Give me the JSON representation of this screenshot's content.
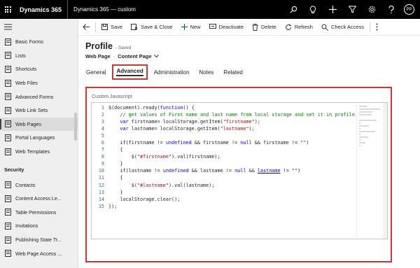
{
  "topbar": {
    "app_title": "Dynamics 365",
    "env_title": "Dynamics 365 — custom",
    "avatar_initials": "PP",
    "icons": [
      "search-icon",
      "lightbulb-icon",
      "plus-icon",
      "filter-icon",
      "gear-icon",
      "help-icon"
    ]
  },
  "sidebar": {
    "items_top": [
      {
        "label": "Basic Forms",
        "icon": "form-icon"
      },
      {
        "label": "Lists",
        "icon": "list-icon"
      },
      {
        "label": "Shortcuts",
        "icon": "shortcut-icon"
      },
      {
        "label": "Web Files",
        "icon": "file-icon"
      },
      {
        "label": "Advanced Forms",
        "icon": "form-icon"
      },
      {
        "label": "Web Link Sets",
        "icon": "link-icon"
      },
      {
        "label": "Web Pages",
        "icon": "page-icon",
        "active": true
      },
      {
        "label": "Portal Languages",
        "icon": "globe-icon"
      },
      {
        "label": "Web Templates",
        "icon": "template-icon"
      }
    ],
    "section": "Security",
    "items_security": [
      {
        "label": "Contacts",
        "icon": "person-icon"
      },
      {
        "label": "Content Access Le...",
        "icon": "document-icon"
      },
      {
        "label": "Table Permissions",
        "icon": "document-icon"
      },
      {
        "label": "Invitations",
        "icon": "mail-icon"
      },
      {
        "label": "Publishing State Tr...",
        "icon": "flow-icon"
      },
      {
        "label": "Web Page Access ...",
        "icon": "document-icon"
      }
    ]
  },
  "commands": {
    "save": "Save",
    "save_close": "Save & Close",
    "new": "New",
    "deactivate": "Deactivate",
    "delete": "Delete",
    "refresh": "Refresh",
    "check_access": "Check Access"
  },
  "record": {
    "title": "Profile",
    "status": "- Saved",
    "entity": "Web Page",
    "form": "Content Page"
  },
  "tabs": [
    "General",
    "Advanced",
    "Administration",
    "Notes",
    "Related"
  ],
  "active_tab": "Advanced",
  "panel": {
    "label": "Custom Javascript",
    "lines": [
      "$(document).ready(function() {",
      "    // get values of First name and last name from local storage and set it in profile",
      "    var firstname= localStorage.getItem(\"firstname\");",
      "    var lastname= localStorage.getItem(\"lastname\");",
      "",
      "    if(firstname != undefined && firstname != null && firstname != \"\")",
      "    {",
      "        $(\"#firstname\").val(firstname);",
      "    }",
      "    if(lastname != undefined && lastname != null && lastname != \"\")",
      "    {",
      "        $(\"#lastname\").val(lastname);",
      "    }",
      "    localStorage.clear();",
      "});"
    ]
  }
}
